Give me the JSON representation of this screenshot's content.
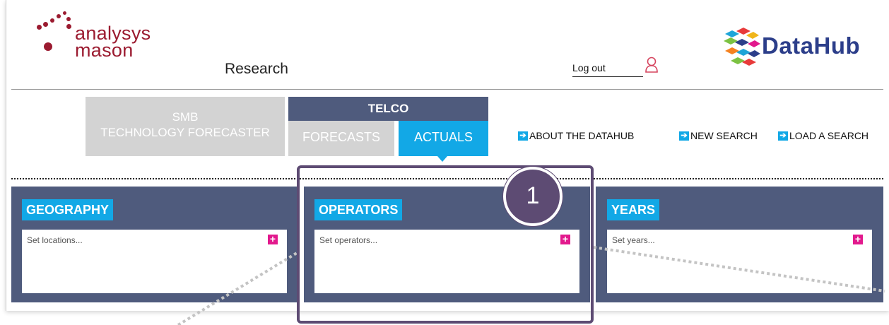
{
  "brand": {
    "logo_line1": "analysys",
    "logo_line2": "mason",
    "section": "Research",
    "product_name": "DataHub",
    "accent": "#9b1b30",
    "product_color": "#2c3e8a"
  },
  "header": {
    "logout_label": "Log out",
    "user_icon": "user-icon"
  },
  "nav": {
    "smb_line1": "SMB",
    "smb_line2": "TECHNOLOGY FORECASTER",
    "telco_label": "TELCO",
    "tab_forecasts": "FORECASTS",
    "tab_actuals": "ACTUALS",
    "active_tab": "ACTUALS",
    "links": [
      {
        "label": "ABOUT THE DATAHUB",
        "icon": "arrow-right-icon"
      },
      {
        "label": "NEW SEARCH",
        "icon": "arrow-right-icon"
      },
      {
        "label": "LOAD A SEARCH",
        "icon": "arrow-right-icon"
      }
    ]
  },
  "panels": [
    {
      "title": "GEOGRAPHY",
      "placeholder": "Set locations..."
    },
    {
      "title": "OPERATORS",
      "placeholder": "Set operators..."
    },
    {
      "title": "YEARS",
      "placeholder": "Set years..."
    }
  ],
  "annotation": {
    "badge": "1",
    "color": "#5d4b73"
  },
  "colors": {
    "panel": "#4f5b7d",
    "active_tab": "#12a8e6",
    "inactive_tab": "#d3d3d3",
    "add_button": "#e2198d"
  }
}
